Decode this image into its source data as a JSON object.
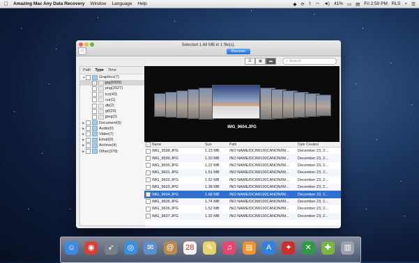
{
  "menubar": {
    "app_name": "Amazing Mac Any Data Recovery",
    "menus": [
      "Window",
      "Language",
      "Help"
    ],
    "battery": "41%",
    "clock": "Fri 2:50 PM",
    "user": "RLS"
  },
  "window": {
    "status_text": "Selected 1.68 MB in 1 file(s).",
    "recover_label": "Recover",
    "search_placeholder": "Search",
    "tabs": [
      "Path",
      "Type",
      "Time"
    ]
  },
  "tree": [
    {
      "label": "Graphics(7)",
      "level": 0,
      "expanded": true,
      "folder": true
    },
    {
      "label": "jpg(6005)",
      "level": 1,
      "selected": true
    },
    {
      "label": "png(2027)",
      "level": 1
    },
    {
      "label": "ico(43)",
      "level": 1
    },
    {
      "label": "cur(1)",
      "level": 1
    },
    {
      "label": "db(2)",
      "level": 1
    },
    {
      "label": "gif(20)",
      "level": 1
    },
    {
      "label": "jpeg(2)",
      "level": 1
    },
    {
      "label": "Document(9)",
      "level": 0,
      "folder": true
    },
    {
      "label": "Audio(0)",
      "level": 0,
      "folder": true
    },
    {
      "label": "Video(7)",
      "level": 0,
      "folder": true
    },
    {
      "label": "Email(0)",
      "level": 0,
      "folder": true
    },
    {
      "label": "Archive(4)",
      "level": 0,
      "folder": true
    },
    {
      "label": "Other(379)",
      "level": 0,
      "folder": true
    }
  ],
  "preview": {
    "caption": "IMG_9604.JPG"
  },
  "table": {
    "headers": [
      "Name",
      "Size",
      "Path",
      "Date Created"
    ],
    "rows": [
      {
        "name": "IMG_9598.JPG",
        "size": "1.23 MB",
        "path": "/NO NAME/DCIM/100CANON/IM...",
        "date": "December 23, 2..."
      },
      {
        "name": "IMG_9599.JPG",
        "size": "1.20 MB",
        "path": "/NO NAME/DCIM/100CANON/IM...",
        "date": "December 23, 2..."
      },
      {
        "name": "IMG_9600.JPG",
        "size": "1.22 MB",
        "path": "/NO NAME/DCIM/100CANON/IM...",
        "date": "December 23, 2..."
      },
      {
        "name": "IMG_9601.JPG",
        "size": "1.51 MB",
        "path": "/NO NAME/DCIM/100CANON/IM...",
        "date": "December 23, 2..."
      },
      {
        "name": "IMG_9602.JPG",
        "size": "1.52 MB",
        "path": "/NO NAME/DCIM/100CANON/IM...",
        "date": "December 23, 2..."
      },
      {
        "name": "IMG_9603.JPG",
        "size": "1.38 MB",
        "path": "/NO NAME/DCIM/100CANON/IM...",
        "date": "December 23, 2..."
      },
      {
        "name": "IMG_9604.JPG",
        "size": "1.68 MB",
        "path": "/NO NAME/DCIM/100CANON/IM...",
        "date": "December 23, 2...",
        "selected": true
      },
      {
        "name": "IMG_9605.JPG",
        "size": "1.74 MB",
        "path": "/NO NAME/DCIM/100CANON/IM...",
        "date": "December 23, 2..."
      },
      {
        "name": "IMG_9606.JPG",
        "size": "1.52 MB",
        "path": "/NO NAME/DCIM/100CANON/IM...",
        "date": "December 23, 2..."
      },
      {
        "name": "IMG_9607.JPG",
        "size": "1.32 MB",
        "path": "/NO NAME/DCIM/100CANON/IM...",
        "date": "December 23, 2..."
      }
    ]
  },
  "dock": [
    {
      "name": "finder-icon",
      "glyph": "☺",
      "color": "#3d8be0"
    },
    {
      "name": "chrome-icon",
      "glyph": "◉",
      "color": "#d64035"
    },
    {
      "name": "launchpad-icon",
      "glyph": "➶",
      "color": "#7a7f8c"
    },
    {
      "name": "safari-icon",
      "glyph": "◎",
      "color": "#3a90e0"
    },
    {
      "name": "mail-icon",
      "glyph": "✉",
      "color": "#5b8fd0"
    },
    {
      "name": "contacts-icon",
      "glyph": "@",
      "color": "#b98a4c"
    },
    {
      "name": "calendar-icon",
      "glyph": "28",
      "color": "#f2f2f2"
    },
    {
      "name": "notes-icon",
      "glyph": "✎",
      "color": "#e9d36a"
    },
    {
      "name": "itunes-icon",
      "glyph": "♫",
      "color": "#e5466d"
    },
    {
      "name": "ibooks-icon",
      "glyph": "▤",
      "color": "#f0932b"
    },
    {
      "name": "app-store-icon",
      "glyph": "A",
      "color": "#2f82e0"
    },
    {
      "name": "santa-app-icon",
      "glyph": "✦",
      "color": "#c9302c"
    },
    {
      "name": "excel-icon",
      "glyph": "✕",
      "color": "#2f9a42"
    },
    {
      "name": "recovery-app-icon",
      "glyph": "✚",
      "color": "#79b640"
    },
    {
      "name": "trash-icon",
      "glyph": "▥",
      "color": "#9aa2ad"
    }
  ]
}
